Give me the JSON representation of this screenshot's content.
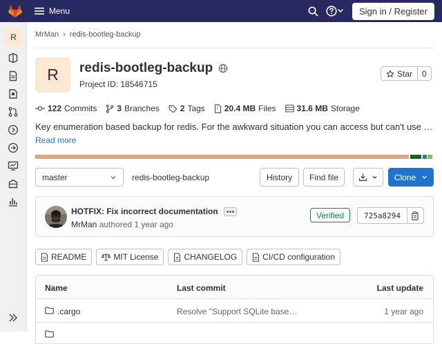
{
  "topbar": {
    "menu_label": "Menu",
    "signin_label": "Sign in / Register"
  },
  "sidebar": {
    "project_initial": "R",
    "items": [
      "project-overview",
      "repository",
      "issues",
      "merge-requests",
      "ci-cd",
      "deployments",
      "monitor",
      "packages",
      "analytics"
    ]
  },
  "breadcrumb": {
    "owner": "MrMan",
    "separator": "›",
    "project": "redis-bootleg-backup"
  },
  "project": {
    "initial": "R",
    "name": "redis-bootleg-backup",
    "id_text": "Project ID: 18546715",
    "star_label": "Star",
    "star_count": "0",
    "description": "Key enumeration based backup for redis. For the awkward situation you can access but can't use …",
    "read_more": "Read more"
  },
  "stats": {
    "commits_count": "122",
    "commits_label": "Commits",
    "branches_count": "3",
    "branches_label": "Branches",
    "tags_count": "2",
    "tags_label": "Tags",
    "files_size": "20.4 MB",
    "files_label": "Files",
    "storage_size": "31.6 MB",
    "storage_label": "Storage"
  },
  "language_bar": {
    "colors": [
      "#dea584",
      "#ffffff",
      "#1b5e20",
      "#ffffff",
      "#3c6fa0",
      "#ffffff",
      "#7cc451"
    ],
    "fractions": [
      0.938,
      0.003,
      0.028,
      0.003,
      0.01,
      0.003,
      0.012
    ]
  },
  "controls": {
    "branch": "master",
    "path": "redis-bootleg-backup",
    "history_label": "History",
    "find_file_label": "Find file",
    "clone_label": "Clone"
  },
  "commit": {
    "title": "HOTFIX: Fix incorrect documentation",
    "author": "MrMan",
    "authored_text": "authored 1 year ago",
    "verified_label": "Verified",
    "sha": "725a8294"
  },
  "pills": {
    "readme": "README",
    "license": "MIT License",
    "changelog": "CHANGELOG",
    "cicd": "CI/CD configuration"
  },
  "files": {
    "headers": {
      "name": "Name",
      "last_commit": "Last commit",
      "last_update": "Last update"
    },
    "rows": [
      {
        "name": ".cargo",
        "last_commit": "Resolve \"Support SQLite base…",
        "last_update": "1 year ago"
      }
    ]
  }
}
